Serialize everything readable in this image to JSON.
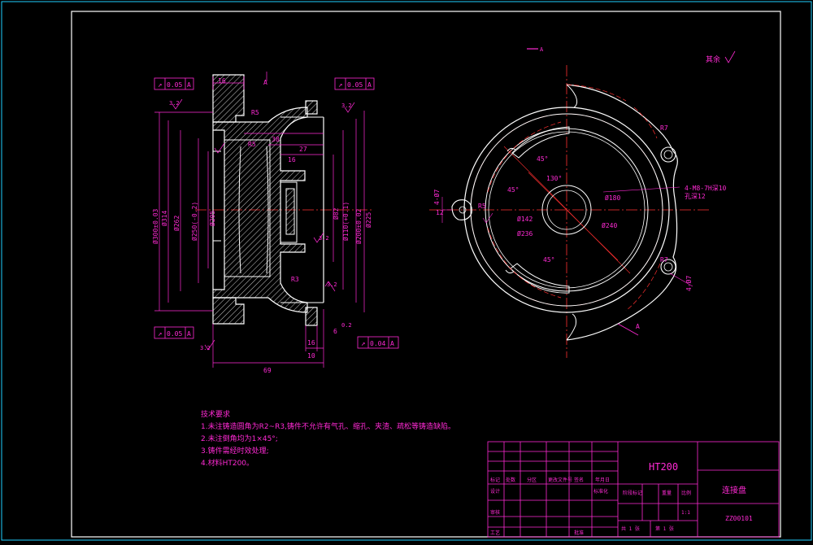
{
  "drawing": {
    "section_view": {
      "tolerance_boxes": [
        {
          "symbol": "↗",
          "value": "0.05",
          "datum": "A"
        },
        {
          "symbol": "↗",
          "value": "0.05",
          "datum": "A"
        },
        {
          "symbol": "↗",
          "value": "0.05",
          "datum": "A"
        },
        {
          "symbol": "↗",
          "value": "0.04",
          "datum": "A"
        }
      ],
      "datum_label": "A",
      "radius_labels": [
        "R5",
        "R5",
        "R3"
      ],
      "roughness": [
        "3.2",
        "3.2",
        "3.2",
        "3.2",
        "3.2"
      ],
      "dims_top": [
        "38",
        "27",
        "16",
        "16"
      ],
      "dims_bottom": [
        "6",
        "0.2",
        "10",
        "69",
        "16"
      ],
      "diameters_left": [
        "Ø300±0.03",
        "Ø314",
        "Ø262",
        "Ø250(-0.2)",
        "Ø205"
      ],
      "diameters_right": [
        "Ø82",
        "Ø110(+0.1)",
        "Ø200±0.02",
        "Ø225"
      ]
    },
    "front_view": {
      "section_mark_top": "A",
      "section_mark_bottom": "A",
      "angles": [
        "45°",
        "130°",
        "45°",
        "45°"
      ],
      "radius_labels": [
        "R7",
        "R7",
        "R5"
      ],
      "diameters": [
        "Ø180",
        "Ø142",
        "Ø240",
        "Ø236"
      ],
      "hole_note": [
        "4-M8-7H深10",
        "孔深12"
      ],
      "side_labels": [
        "4-Ø7",
        "4-Ø7",
        "12",
        "R5"
      ],
      "roughness_other": "其余"
    },
    "tech_requirements": {
      "title": "技术要求",
      "items": [
        "1.未注铸造圆角为R2~R3,铸件不允许有气孔、缩孔、夹渣、疏松等铸造缺陷。",
        "2.未注倒角均为1×45°;",
        "3.铸件需经时效处理;",
        "4.材料HT200。"
      ]
    },
    "title_block": {
      "material": "HT200",
      "part_name": "连接盘",
      "drawing_no": "ZZ00101",
      "labels": [
        "标记",
        "处数",
        "分区",
        "更改文件号",
        "签名",
        "年月日",
        "设计",
        "标准化",
        "阶段标记",
        "重量",
        "比例",
        "审核",
        "工艺",
        "批准",
        "共 1 张",
        "第 1 张"
      ],
      "scale": "1:1"
    }
  },
  "colors": {
    "frame": "#ffffff",
    "outline": "#ffffff",
    "dimension": "#ff2ad4",
    "centerline": "#ff3030",
    "hatch": "#ffffff"
  }
}
